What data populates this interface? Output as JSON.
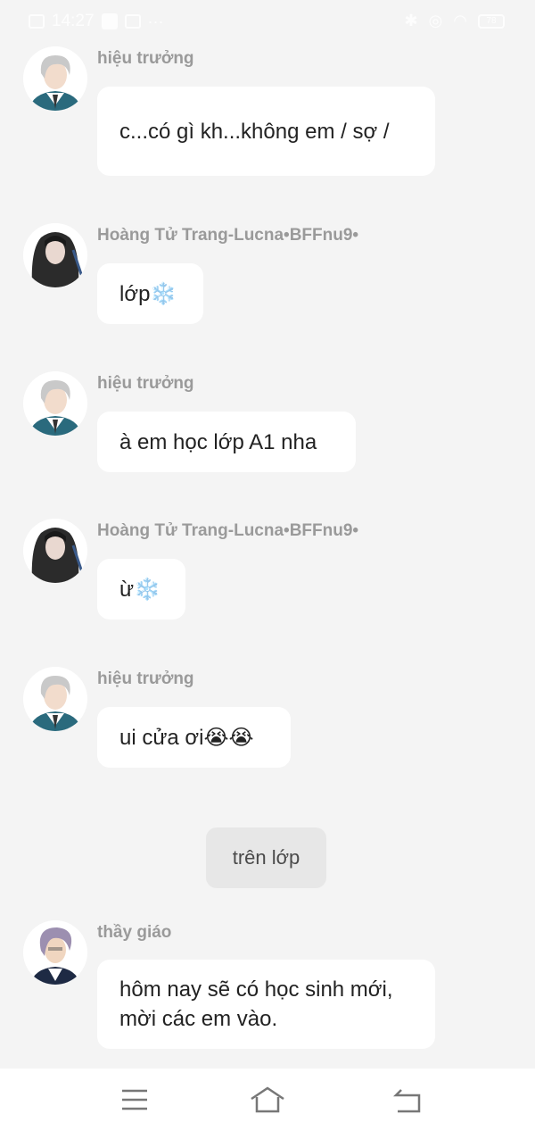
{
  "status_bar": {
    "time": "14:27",
    "battery": "78"
  },
  "messages": [
    {
      "sender": "hiệu trưởng",
      "text": "c...có gì kh...không em / sợ /"
    },
    {
      "sender": "Hoàng Tử Trang-Lucna•BFFnu9•",
      "text": "lớp❄️"
    },
    {
      "sender": "hiệu trưởng",
      "text": "à em học lớp A1 nha"
    },
    {
      "sender": "Hoàng Tử Trang-Lucna•BFFnu9•",
      "text": "ừ❄️"
    },
    {
      "sender": "hiệu trưởng",
      "text": "ui cửa ơi😭😭"
    },
    {
      "sender": "thầy giáo",
      "text": "hôm nay sẽ có học sinh mới, mời các em vào."
    }
  ],
  "narration": "trên lớp",
  "nav_bar": {
    "menu_icon": "menu-icon",
    "home_icon": "home-icon",
    "back_icon": "back-icon"
  }
}
